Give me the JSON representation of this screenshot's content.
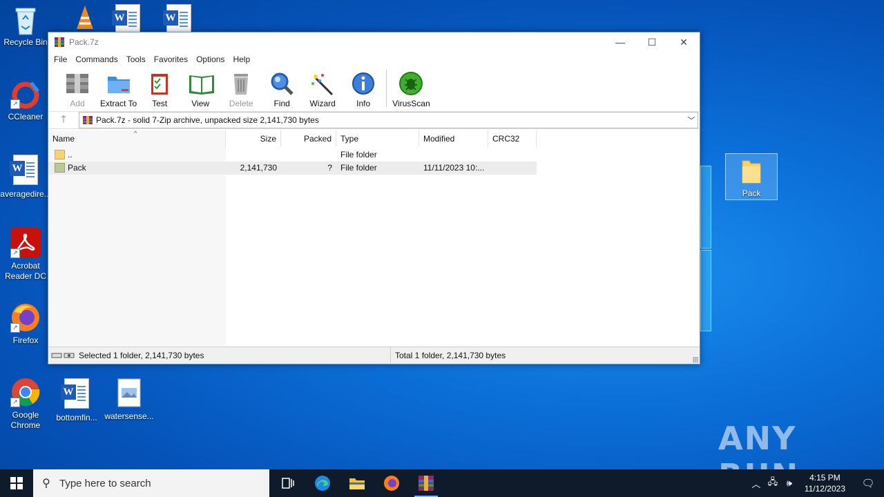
{
  "desktop": {
    "icons": [
      {
        "label": "Recycle Bin"
      },
      {
        "label": "CCleaner"
      },
      {
        "label": "averagedire..."
      },
      {
        "label": "Acrobat Reader DC"
      },
      {
        "label": "Firefox"
      },
      {
        "label": "Google Chrome"
      },
      {
        "label": "bottomfin..."
      },
      {
        "label": "watersense..."
      },
      {
        "label": "Pack"
      }
    ]
  },
  "window": {
    "title": "Pack.7z",
    "menu": [
      "File",
      "Commands",
      "Tools",
      "Favorites",
      "Options",
      "Help"
    ],
    "toolbar": [
      "Add",
      "Extract To",
      "Test",
      "View",
      "Delete",
      "Find",
      "Wizard",
      "Info",
      "VirusScan"
    ],
    "address": "Pack.7z - solid 7-Zip archive, unpacked size 2,141,730 bytes",
    "columns": [
      "Name",
      "Size",
      "Packed",
      "Type",
      "Modified",
      "CRC32"
    ],
    "rows": [
      {
        "name": "..",
        "size": "",
        "packed": "",
        "type": "File folder",
        "modified": "",
        "crc": ""
      },
      {
        "name": "Pack",
        "size": "2,141,730",
        "packed": "?",
        "type": "File folder",
        "modified": "11/11/2023 10:...",
        "crc": ""
      }
    ],
    "status_left": "Selected 1 folder, 2,141,730 bytes",
    "status_right": "Total 1 folder, 2,141,730 bytes"
  },
  "watermark": "ANY RUN",
  "taskbar": {
    "search_placeholder": "Type here to search",
    "time": "4:15 PM",
    "date": "11/12/2023"
  }
}
